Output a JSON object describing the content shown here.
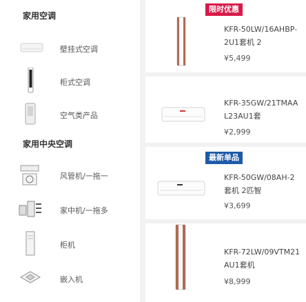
{
  "left": {
    "section1_title": "家用空调",
    "section1_items": [
      "壁挂式空调",
      "柜式空调",
      "空气类产品"
    ],
    "section2_title": "家用中央空调",
    "section2_items": [
      "风管机/一拖一",
      "家中机/一拖多",
      "柜机",
      "嵌入机"
    ]
  },
  "products": [
    {
      "badge": "限时优惠",
      "name": "KFR-50LW/16AHBP-2U1套机 2",
      "price": "¥5,499"
    },
    {
      "badge": "",
      "name": "KFR-35GW/21TMAAL23AU1套",
      "price": "¥2,999"
    },
    {
      "badge": "最新单品",
      "name": "KFR-50GW/08AH-2套机 2匹智",
      "price": "¥3,699"
    },
    {
      "badge": "",
      "name": "KFR-72LW/09VTM21AU1套机",
      "price": "¥8,999"
    }
  ],
  "colors": {
    "badge_sale": "#d8194a",
    "badge_new": "#1e5aa8"
  }
}
